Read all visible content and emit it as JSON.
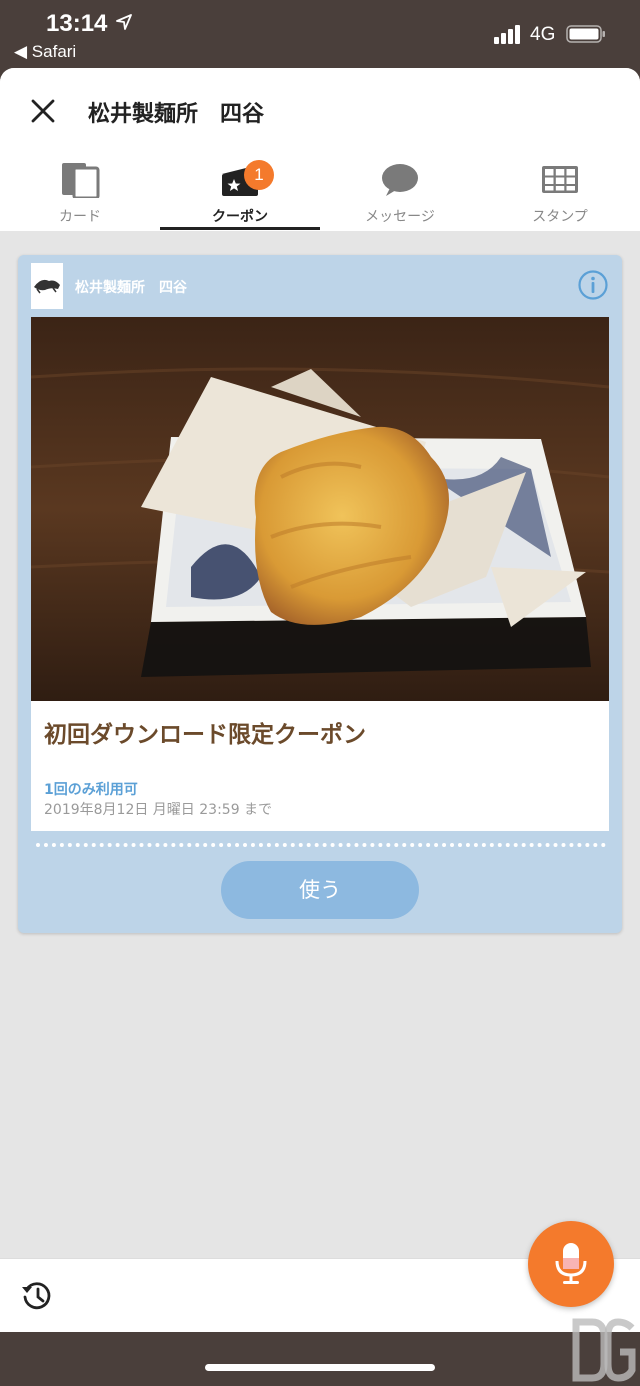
{
  "status_bar": {
    "time": "13:14",
    "back_app": "◀ Safari",
    "network": "4G"
  },
  "header": {
    "title": "松井製麺所　四谷"
  },
  "tabs": [
    {
      "label": "カード",
      "icon": "card-icon"
    },
    {
      "label": "クーポン",
      "icon": "coupon-icon",
      "badge": "1",
      "active": true
    },
    {
      "label": "メッセージ",
      "icon": "message-icon"
    },
    {
      "label": "スタンプ",
      "icon": "stamp-icon"
    }
  ],
  "coupon": {
    "shop_name": "松井製麺所　四谷",
    "title": "初回ダウンロード限定クーポン",
    "limit": "1回のみ利用可",
    "expiry": "2019年8月12日 月曜日 23:59 まで",
    "use_label": "使う"
  },
  "colors": {
    "accent": "#f47a2c",
    "coupon_bg": "#bdd4e8",
    "button": "#8db9e0",
    "title_brown": "#6b4a2b",
    "link_blue": "#5ba0d6"
  }
}
